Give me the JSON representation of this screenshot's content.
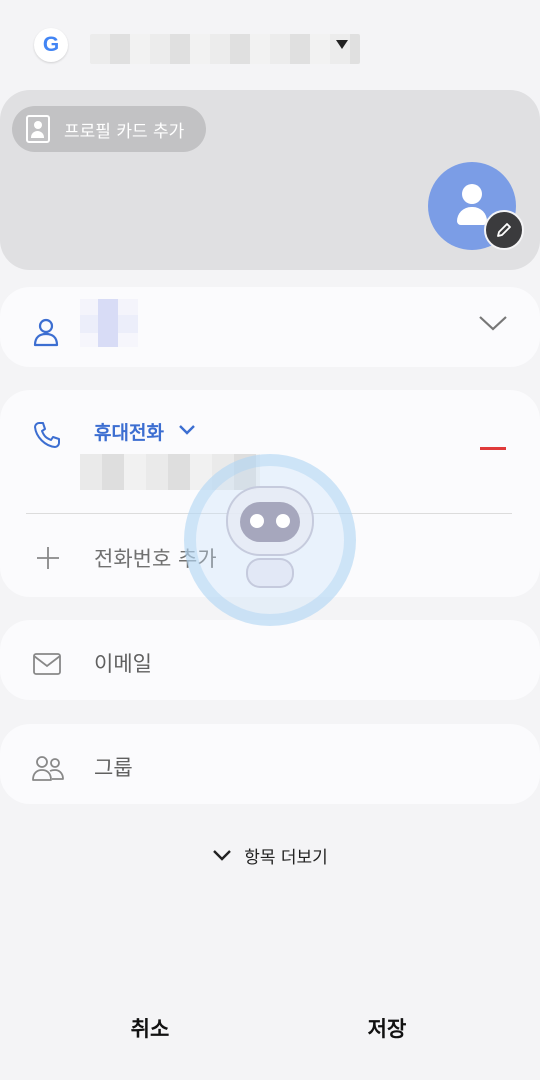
{
  "account": {
    "logo_letter": "G",
    "icon": "google-logo-icon"
  },
  "profile": {
    "chip_label": "프로필 카드 추가",
    "avatar_icon": "person-icon",
    "edit_icon": "pencil-icon"
  },
  "name_field": {
    "icon": "person-outline-icon",
    "expand_icon": "chevron-down-icon"
  },
  "phone_field": {
    "icon": "phone-icon",
    "type_label": "휴대전화",
    "type_caret_icon": "chevron-down-icon",
    "remove_icon": "minus-icon",
    "add_label": "전화번호 추가",
    "add_icon": "plus-icon"
  },
  "email_field": {
    "icon": "mail-icon",
    "placeholder": "이메일"
  },
  "group_field": {
    "icon": "group-icon",
    "placeholder": "그룹"
  },
  "more_fields": {
    "label": "항목 더보기",
    "icon": "chevron-down-icon"
  },
  "buttons": {
    "cancel": "취소",
    "save": "저장"
  },
  "colors": {
    "accent": "#3c6ed1",
    "remove": "#e03a3a",
    "avatar": "#7b9de6"
  }
}
